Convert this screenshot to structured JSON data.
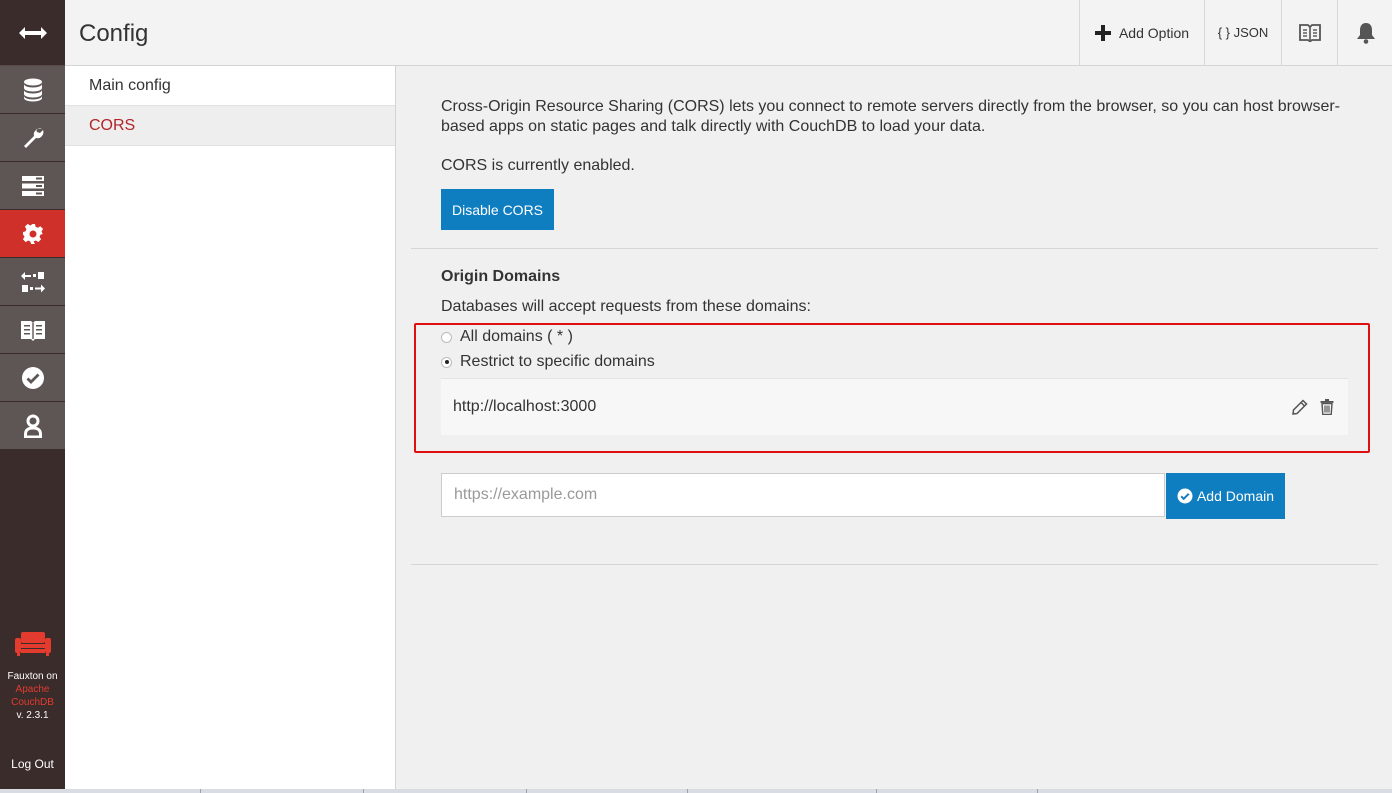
{
  "header": {
    "title": "Config",
    "add_option_label": "Add Option",
    "json_label": "{ } JSON"
  },
  "sidebar": {
    "items": [
      {
        "label": "Main config"
      },
      {
        "label": "CORS"
      }
    ]
  },
  "nav": {
    "footer_line1": "Fauxton on",
    "footer_line2": "Apache",
    "footer_line3": "CouchDB",
    "version": "v. 2.3.1",
    "logout": "Log Out"
  },
  "main": {
    "description": "Cross-Origin Resource Sharing (CORS) lets you connect to remote servers directly from the browser, so you can host browser-based apps on static pages and talk directly with CouchDB to load your data.",
    "status": "CORS is currently enabled.",
    "disable_button": "Disable CORS",
    "origin_title": "Origin Domains",
    "origin_desc": "Databases will accept requests from these domains:",
    "radio_all": "All domains ( * )",
    "radio_restrict": "Restrict to specific domains",
    "domains": [
      {
        "url": "http://localhost:3000"
      }
    ],
    "new_domain_placeholder": "https://example.com",
    "add_domain_button": "Add Domain"
  },
  "colors": {
    "accent_red": "#d0302a",
    "primary_blue": "#0f7ec0",
    "highlight_border": "#e01010"
  }
}
